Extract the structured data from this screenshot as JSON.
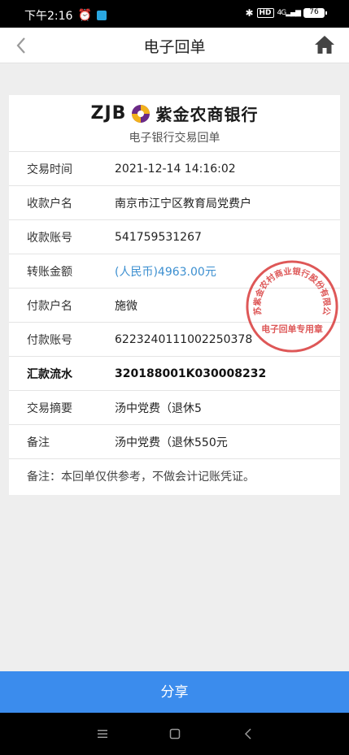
{
  "status_bar": {
    "time": "下午2:16",
    "network": "HD",
    "signal": "4G",
    "battery": "76"
  },
  "nav": {
    "title": "电子回单"
  },
  "receipt": {
    "logo_text": "ZJB",
    "bank_name": "紫金农商银行",
    "subtitle": "电子银行交易回单",
    "rows": [
      {
        "label": "交易时间",
        "value": "2021-12-14 14:16:02"
      },
      {
        "label": "收款户名",
        "value": "南京市江宁区教育局党费户"
      },
      {
        "label": "收款账号",
        "value": "541759531267"
      },
      {
        "label": "转账金额",
        "value": "(人民币)4963.00元"
      },
      {
        "label": "付款户名",
        "value": "施微"
      },
      {
        "label": "付款账号",
        "value": "6223240111002250378"
      },
      {
        "label": "汇款流水",
        "value": "320188001K030008232"
      },
      {
        "label": "交易摘要",
        "value": "汤中党费（退休5"
      },
      {
        "label": "备注",
        "value": "汤中党费（退休550元"
      }
    ],
    "note": "备注：本回单仅供参考，不做会计记账凭证。"
  },
  "stamp": {
    "ring_text": "江苏紫金农村商业银行股份有限公司",
    "center_text": "电子回单专用章",
    "color": "#d83a3a"
  },
  "share_button": {
    "label": "分享"
  },
  "colors": {
    "accent": "#3b8ced",
    "amount": "#3c8fd0"
  }
}
